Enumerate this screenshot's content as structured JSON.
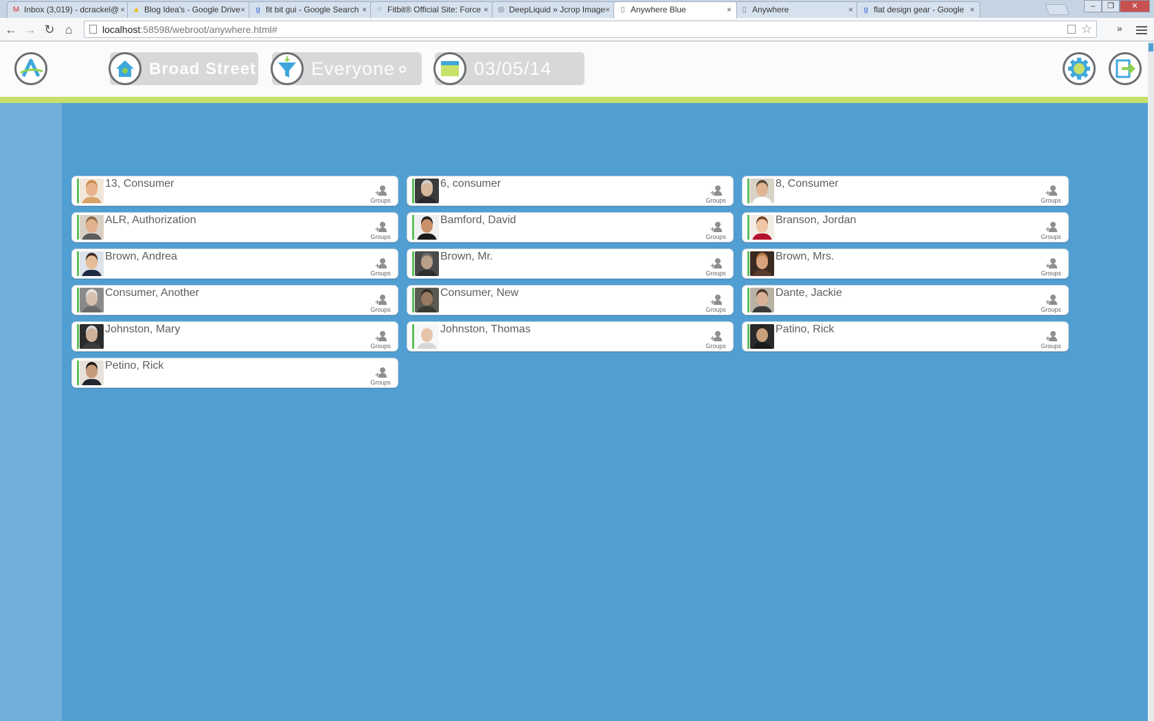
{
  "browser": {
    "tabs": [
      {
        "title": "Inbox (3,019) - dcrackel@",
        "icon": "M",
        "icon_color": "#d93025",
        "active": false
      },
      {
        "title": "Blog Idea's - Google Drive",
        "icon": "▲",
        "icon_color": "#f4b400",
        "active": false
      },
      {
        "title": "fit bit gui - Google Search",
        "icon": "g",
        "icon_color": "#3367d6",
        "active": false
      },
      {
        "title": "Fitbit® Official Site: Force",
        "icon": "⁘",
        "icon_color": "#2f6f8f",
        "active": false
      },
      {
        "title": "DeepLiquid » Jcrop Image",
        "icon": "◎",
        "icon_color": "#5b6b8a",
        "active": false
      },
      {
        "title": "Anywhere Blue",
        "icon": "▯",
        "icon_color": "#777777",
        "active": true
      },
      {
        "title": "Anywhere",
        "icon": "▯",
        "icon_color": "#777777",
        "active": false
      },
      {
        "title": "flat design gear - Google",
        "icon": "g",
        "icon_color": "#3367d6",
        "active": false
      }
    ],
    "close_glyph": "×",
    "url_host": "localhost",
    "url_rest": ":58598/webroot/anywhere.html#"
  },
  "header": {
    "location": "Broad Street",
    "filter": "Everyone",
    "date": "03/05/14"
  },
  "colors": {
    "main_bg": "#519fd2",
    "sidebar_bg": "#72b0d9",
    "accent_green": "#c6e06a",
    "icon_blue": "#3fa7dc",
    "icon_green": "#8fd14f"
  },
  "groups_label": "Groups",
  "consumers": [
    {
      "name": "13, Consumer",
      "skin": "#e8b48f",
      "hair": "#c98b4a",
      "bg": "#f2e6d8",
      "shirt": "#d9a36a"
    },
    {
      "name": "6, consumer",
      "skin": "#d7b79c",
      "hair": "#cfcfcf",
      "bg": "#3b3b3b",
      "shirt": "#2a2a2a"
    },
    {
      "name": "8, Consumer",
      "skin": "#e0b593",
      "hair": "#5a4a3a",
      "bg": "#d8d3c7",
      "shirt": "#ffffff"
    },
    {
      "name": "ALR, Authorization",
      "skin": "#e2b28e",
      "hair": "#8b6a4a",
      "bg": "#d9d0c4",
      "shirt": "#5b5b5b"
    },
    {
      "name": "Bamford, David",
      "skin": "#c9906a",
      "hair": "#222222",
      "bg": "#efefef",
      "shirt": "#1a1a1a"
    },
    {
      "name": "Branson, Jordan",
      "skin": "#f0c6a6",
      "hair": "#7a4a2a",
      "bg": "#f2ece4",
      "shirt": "#b3122e"
    },
    {
      "name": "Brown, Andrea",
      "skin": "#e6bb98",
      "hair": "#3a2a1f",
      "bg": "#dde3ea",
      "shirt": "#1f2a44"
    },
    {
      "name": "Brown, Mr.",
      "skin": "#b9a08a",
      "hair": "#6a6a6a",
      "bg": "#4a4a4a",
      "shirt": "#2e2e2e"
    },
    {
      "name": "Brown, Mrs.",
      "skin": "#d9a27e",
      "hair": "#b87a46",
      "bg": "#3b2a22",
      "shirt": "#5a3a2a"
    },
    {
      "name": "Consumer, Another",
      "skin": "#d6c1b0",
      "hair": "#e6e6e6",
      "bg": "#8a8a8a",
      "shirt": "#6b6b6b"
    },
    {
      "name": "Consumer, New",
      "skin": "#9a7a60",
      "hair": "#2f2a26",
      "bg": "#5a5a50",
      "shirt": "#3b3b34"
    },
    {
      "name": "Dante, Jackie",
      "skin": "#d8b097",
      "hair": "#4a3426",
      "bg": "#b8b1a6",
      "shirt": "#3a3a3a"
    },
    {
      "name": "Johnston, Mary",
      "skin": "#cfb19a",
      "hair": "#d8d8d8",
      "bg": "#2c2c2c",
      "shirt": "#3c3c3c"
    },
    {
      "name": "Johnston, Thomas",
      "skin": "#e7c3a8",
      "hair": "#f3f3f3",
      "bg": "#f7f7f7",
      "shirt": "#d7d7d7"
    },
    {
      "name": "Patino, Rick",
      "skin": "#c8a07e",
      "hair": "#2e231c",
      "bg": "#2a2a2a",
      "shirt": "#1a1a1a"
    },
    {
      "name": "Petino, Rick",
      "skin": "#c79c7b",
      "hair": "#1e1a17",
      "bg": "#e6e1da",
      "shirt": "#22262e"
    }
  ]
}
